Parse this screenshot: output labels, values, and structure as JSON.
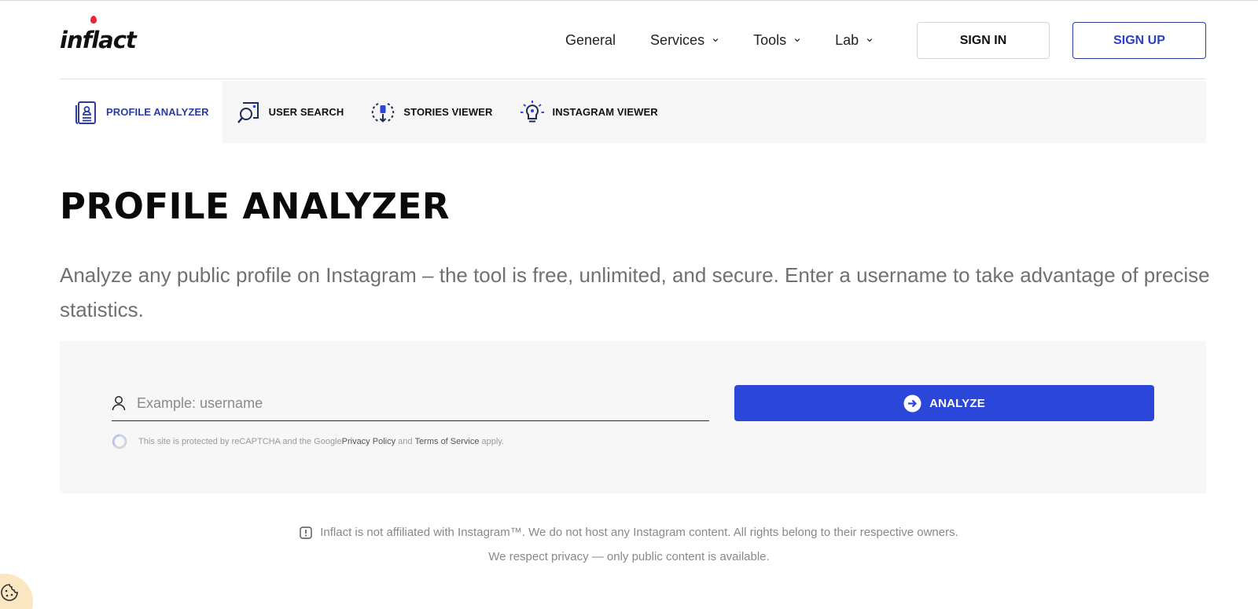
{
  "header": {
    "logo_text": "inflact",
    "nav": [
      {
        "label": "General",
        "has_dropdown": false
      },
      {
        "label": "Services",
        "has_dropdown": true
      },
      {
        "label": "Tools",
        "has_dropdown": true
      },
      {
        "label": "Lab",
        "has_dropdown": true
      }
    ],
    "sign_in_label": "SIGN IN",
    "sign_up_label": "SIGN UP"
  },
  "tabs": [
    {
      "label": "PROFILE ANALYZER",
      "icon": "profile-card-icon",
      "active": true
    },
    {
      "label": "USER SEARCH",
      "icon": "user-search-icon",
      "active": false
    },
    {
      "label": "STORIES VIEWER",
      "icon": "stories-download-icon",
      "active": false
    },
    {
      "label": "INSTAGRAM VIEWER",
      "icon": "lightbulb-icon",
      "active": false
    }
  ],
  "main": {
    "title": "PROFILE ANALYZER",
    "description": "Analyze any public profile on Instagram – the tool is free, unlimited, and secure. Enter a username to take advantage of precise statistics."
  },
  "form": {
    "username_placeholder": "Example: username",
    "username_value": "",
    "analyze_label": "ANALYZE",
    "recaptcha_prefix": "This site is protected by reCAPTCHA and the Google ",
    "privacy_link": "Privacy Policy",
    "and_text": " and ",
    "terms_link": "Terms of Service",
    "apply_text": " apply."
  },
  "disclaimer": {
    "line1": "Inflact is not affiliated with Instagram™. We do not host any Instagram content. All rights belong to their respective owners.",
    "line2": "We respect privacy — only public content is available."
  },
  "colors": {
    "accent": "#2b47d9",
    "active_tab_text": "#2b3c9c",
    "logo_drop": "#e8253c"
  }
}
